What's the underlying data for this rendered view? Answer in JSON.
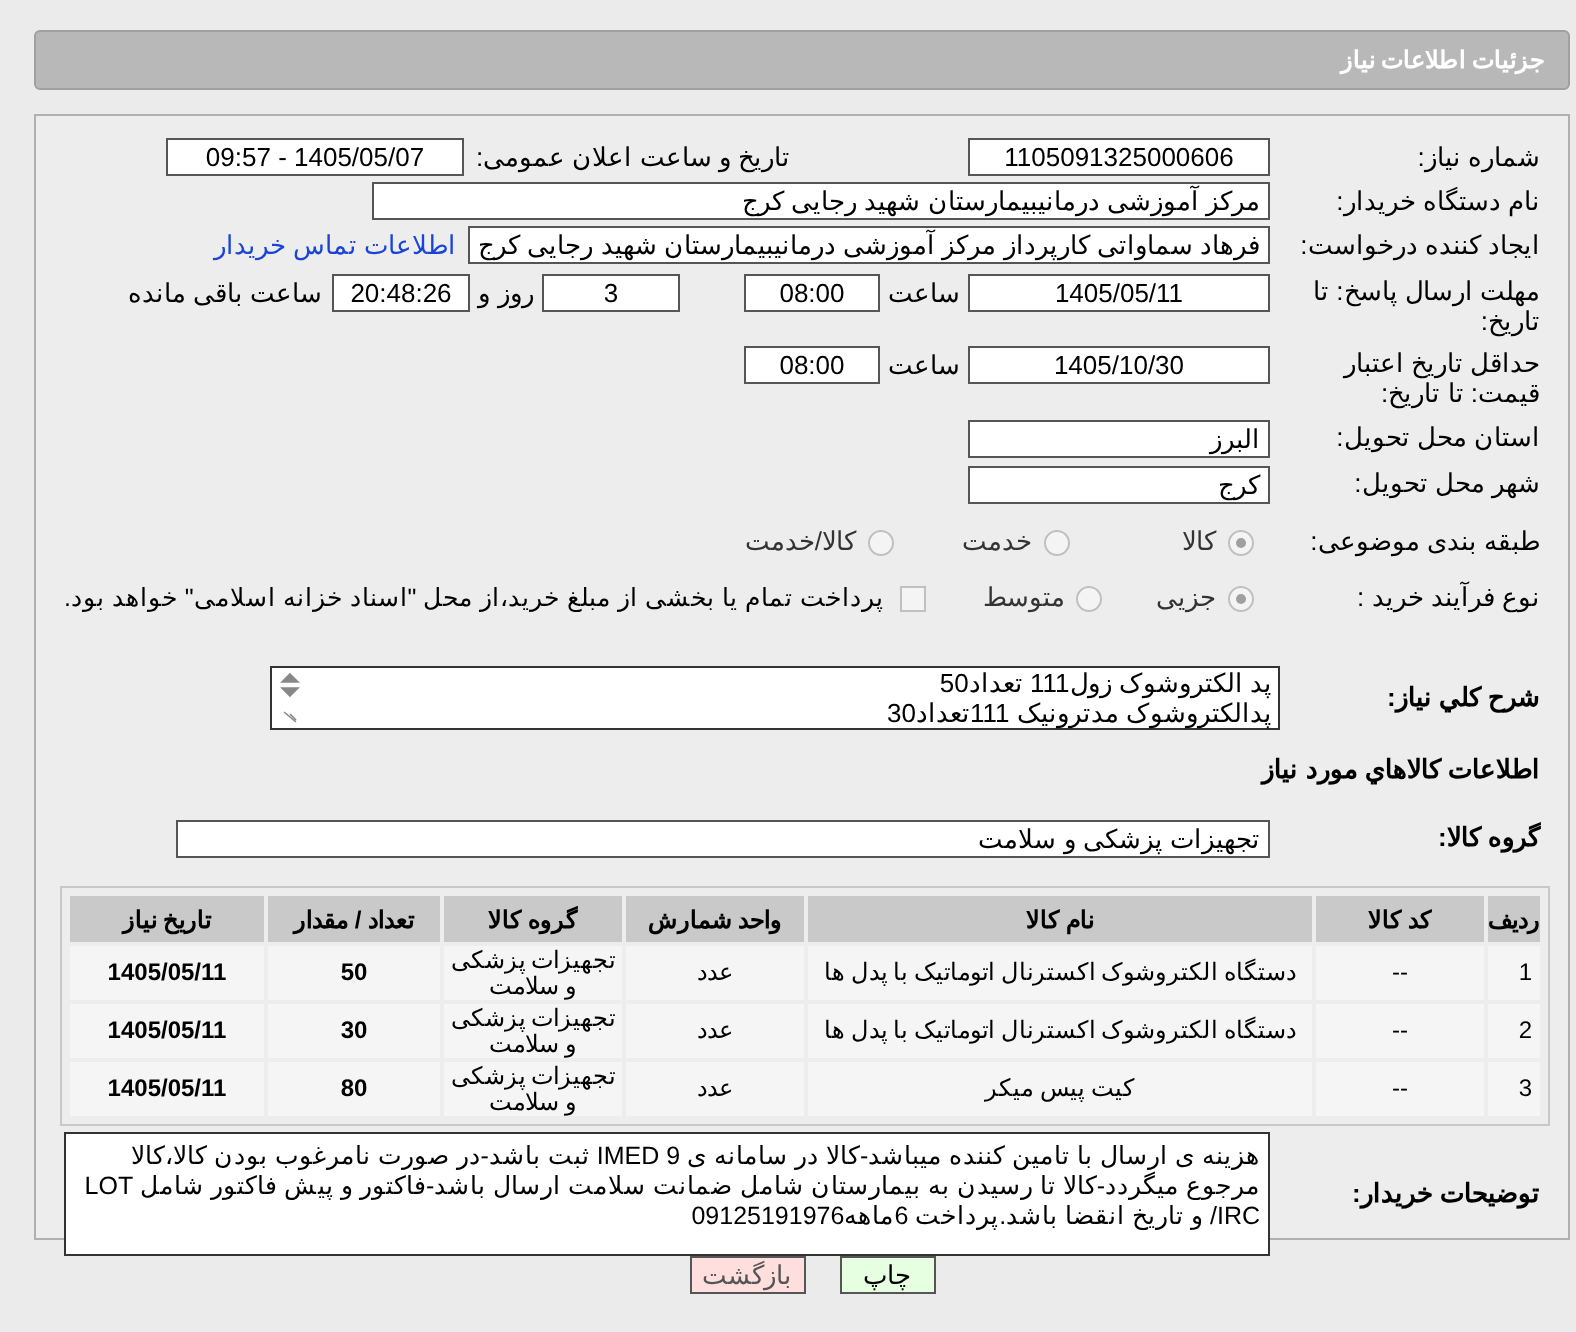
{
  "title": "جزئیات اطلاعات نیاز",
  "need_number": {
    "label": "شماره نیاز:",
    "value": "1105091325000606"
  },
  "announce": {
    "label": "تاریخ و ساعت اعلان عمومی:",
    "value": "1405/05/07 - 09:57"
  },
  "buyer_org": {
    "label": "نام دستگاه خریدار:",
    "value": "مرکز آموزشی درمانیبیمارستان شهید رجایی کرج"
  },
  "creator": {
    "label": "ایجاد کننده درخواست:",
    "value": "فرهاد سماواتی کارپرداز مرکز آموزشی درمانیبیمارستان شهید رجایی کرج",
    "link": "اطلاعات تماس خریدار"
  },
  "deadline": {
    "label": "مهلت ارسال پاسخ: تا تاریخ:",
    "date": "1405/05/11",
    "time_label": "ساعت",
    "time": "08:00",
    "days": "3",
    "days_label": "روز و",
    "remaining": "20:48:26",
    "remaining_label": "ساعت باقی مانده"
  },
  "validity": {
    "label": "حداقل تاریخ اعتبار قیمت: تا تاریخ:",
    "date": "1405/10/30",
    "time_label": "ساعت",
    "time": "08:00"
  },
  "province": {
    "label": "استان محل تحویل:",
    "value": "البرز"
  },
  "city": {
    "label": "شهر محل تحویل:",
    "value": "کرج"
  },
  "category": {
    "label": "طبقه بندی موضوعی:",
    "options": [
      {
        "label": "کالا",
        "selected": true
      },
      {
        "label": "خدمت",
        "selected": false
      },
      {
        "label": "کالا/خدمت",
        "selected": false
      }
    ]
  },
  "process": {
    "label": "نوع فرآیند خرید :",
    "options": [
      {
        "label": "جزیی",
        "selected": true
      },
      {
        "label": "متوسط",
        "selected": false
      }
    ],
    "payment": {
      "label": "پرداخت تمام یا بخشی از مبلغ خرید،از محل \"اسناد خزانه اسلامی\" خواهد بود.",
      "checked": false
    }
  },
  "description": {
    "label": "شرح كلي نياز:",
    "lines": [
      "پد الکتروشوک زول111 تعداد50",
      "پدالکتروشوک مدترونیک 111تعداد30"
    ]
  },
  "items_heading": "اطلاعات كالاهاي مورد نياز",
  "goods_group": {
    "label": "گروه کالا:",
    "value": "تجهیزات پزشکی و سلامت"
  },
  "table": {
    "columns": [
      "ردیف",
      "کد کالا",
      "نام کالا",
      "واحد شمارش",
      "گروه کالا",
      "تعداد / مقدار",
      "تاریخ نیاز"
    ],
    "rows": [
      [
        "1",
        "--",
        "دستگاه الکتروشوک اکسترنال اتوماتیک با پدل ها",
        "عدد",
        "تجهیزات پزشکی و سلامت",
        "50",
        "1405/05/11"
      ],
      [
        "2",
        "--",
        "دستگاه الکتروشوک اکسترنال اتوماتیک با پدل ها",
        "عدد",
        "تجهیزات پزشکی و سلامت",
        "30",
        "1405/05/11"
      ],
      [
        "3",
        "--",
        "کیت پیس میکر",
        "عدد",
        "تجهیزات پزشکی و سلامت",
        "80",
        "1405/05/11"
      ]
    ]
  },
  "notes": {
    "label": "توضیحات خریدار:",
    "value": "هزینه ی ارسال با تامین کننده میباشد-کالا در سامانه ی IMED 9 ثبت باشد-در صورت نامرغوب بودن کالا،کالا مرجوع میگردد-کالا تا رسیدن به بیمارستان شامل ضمانت سلامت ارسال باشد-فاکتور و پیش فاکتور شامل LOT /IRC و تاریخ انقضا باشد.پرداخت 6ماهه09125191976"
  },
  "buttons": [
    {
      "label": "چاپ",
      "kind": "print"
    },
    {
      "label": "بازگشت",
      "kind": "back"
    }
  ]
}
